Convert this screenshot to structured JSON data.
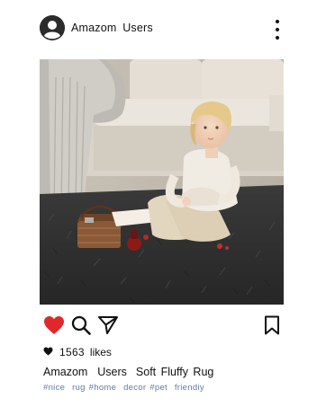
{
  "post": {
    "username": "Amazom  Users",
    "likes_count": "1563",
    "likes_label": "likes",
    "caption_user": "Amazom  Users",
    "caption_text": "Soft Fluffy Rug",
    "hashtags": "#nice  rug #home  decor #pet  friendiy"
  },
  "icons": {
    "avatar": "user-avatar-icon",
    "more": "more-vertical-icon",
    "like": "heart-icon",
    "search": "search-icon",
    "share": "send-icon",
    "save": "bookmark-icon",
    "likes_heart": "heart-icon"
  },
  "colors": {
    "like_red": "#e0282b",
    "hashtag_blue": "#5f7aa8",
    "text": "#111111"
  }
}
